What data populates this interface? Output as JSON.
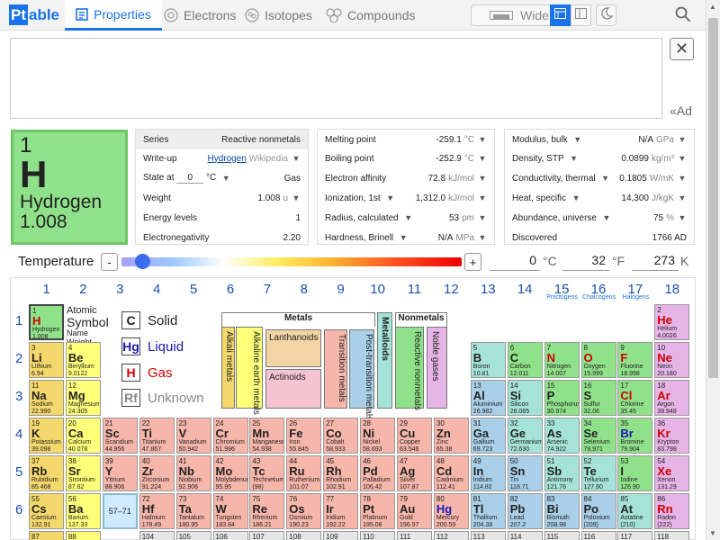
{
  "app": {
    "logo_pt": "Pt",
    "logo_rest": "able"
  },
  "tabs": [
    {
      "label": "Properties"
    },
    {
      "label": "Electrons"
    },
    {
      "label": "Isotopes"
    },
    {
      "label": "Compounds"
    }
  ],
  "toolbar": {
    "wide_label": "Wide"
  },
  "search": {
    "add_hint": "«Ad"
  },
  "element": {
    "number": "1",
    "symbol": "H",
    "name": "Hydrogen",
    "weight": "1.008",
    "color": "#90e28a"
  },
  "panel1": {
    "series_label": "Series",
    "series_value": "Reactive nonmetals",
    "writeup_label": "Write-up",
    "writeup_link": "Hydrogen",
    "writeup_source": "Wikipedia",
    "state_label": "State at",
    "state_temp": "0",
    "state_unit": "°C",
    "state_value": "Gas",
    "weight_label": "Weight",
    "weight_value": "1.008",
    "weight_unit": "u",
    "energy_label": "Energy levels",
    "energy_value": "1",
    "eneg_label": "Electronegativity",
    "eneg_value": "2.20"
  },
  "panel2": {
    "melt_label": "Melting point",
    "melt_value": "-259.1",
    "melt_unit": "°C",
    "boil_label": "Boiling point",
    "boil_value": "-252.9",
    "boil_unit": "°C",
    "ea_label": "Electron affinity",
    "ea_value": "72.8",
    "ea_unit": "kJ/mol",
    "ion_label": "Ionization, 1st",
    "ion_value": "1,312.0",
    "ion_unit": "kJ/mol",
    "rad_label": "Radius, calculated",
    "rad_value": "53",
    "rad_unit": "pm",
    "hard_label": "Hardness, Brinell",
    "hard_value": "N/A",
    "hard_unit": "MPa"
  },
  "panel3": {
    "mod_label": "Modulus, bulk",
    "mod_value": "N/A",
    "mod_unit": "GPa",
    "dens_label": "Density, STP",
    "dens_value": "0.0899",
    "dens_unit": "kg/m³",
    "cond_label": "Conductivity, thermal",
    "cond_value": "0.1805",
    "cond_unit": "W/mK",
    "heat_label": "Heat, specific",
    "heat_value": "14,300",
    "heat_unit": "J/kgK",
    "abund_label": "Abundance, universe",
    "abund_value": "75",
    "abund_unit": "%",
    "disc_label": "Discovered",
    "disc_value": "1766 AD"
  },
  "temperature": {
    "label": "Temperature",
    "minus": "-",
    "plus": "+",
    "celsius": "0",
    "c_unit": "°C",
    "fahrenheit": "32",
    "f_unit": "°F",
    "kelvin": "273",
    "k_unit": "K"
  },
  "groups": [
    "1",
    "2",
    "3",
    "4",
    "5",
    "6",
    "7",
    "8",
    "9",
    "10",
    "11",
    "12",
    "13",
    "14",
    "15",
    "16",
    "17",
    "18"
  ],
  "group_names": {
    "g15": "Pnictogens",
    "g16": "Chalcogens",
    "g17": "Halogens"
  },
  "periods": [
    "1",
    "2",
    "3",
    "4",
    "5",
    "6"
  ],
  "key": {
    "atomic": "Atomic",
    "symbol": "Symbol",
    "name": "Name",
    "weight": "Weight"
  },
  "legend": {
    "solid_sym": "C",
    "solid": "Solid",
    "liquid_sym": "Hg",
    "liquid": "Liquid",
    "gas_sym": "H",
    "gas": "Gas",
    "unk_sym": "Rf",
    "unknown": "Unknown"
  },
  "categories": {
    "metals": "Metals",
    "alkali": "Alkali metals",
    "alkaline": "Alkaline earth metals",
    "lanthanoids": "Lanthanoids",
    "actinoids": "Actinoids",
    "transition": "Transition metals",
    "post": "Post-transition metals",
    "metalloids": "Metalloids",
    "nonmetals": "Nonmetals",
    "reactive": "Reactive nonmetals",
    "noble": "Noble gases"
  },
  "lanth_placeholder": "57–71",
  "elements": [
    {
      "n": "1",
      "s": "H",
      "nm": "Hydrogen",
      "w": "1.008",
      "g": 1,
      "p": 1,
      "c": "rn",
      "st": "gas"
    },
    {
      "n": "2",
      "s": "He",
      "nm": "Helium",
      "w": "4.0026",
      "g": 18,
      "p": 1,
      "c": "ng",
      "st": "gas"
    },
    {
      "n": "3",
      "s": "Li",
      "nm": "Lithium",
      "w": "6.94",
      "g": 1,
      "p": 2,
      "c": "alk"
    },
    {
      "n": "4",
      "s": "Be",
      "nm": "Beryllium",
      "w": "9.0122",
      "g": 2,
      "p": 2,
      "c": "ae"
    },
    {
      "n": "5",
      "s": "B",
      "nm": "Boron",
      "w": "10.81",
      "g": 13,
      "p": 2,
      "c": "met"
    },
    {
      "n": "6",
      "s": "C",
      "nm": "Carbon",
      "w": "12.011",
      "g": 14,
      "p": 2,
      "c": "rn"
    },
    {
      "n": "7",
      "s": "N",
      "nm": "Nitrogen",
      "w": "14.007",
      "g": 15,
      "p": 2,
      "c": "rn",
      "st": "gas"
    },
    {
      "n": "8",
      "s": "O",
      "nm": "Oxygen",
      "w": "15.999",
      "g": 16,
      "p": 2,
      "c": "rn",
      "st": "gas"
    },
    {
      "n": "9",
      "s": "F",
      "nm": "Fluorine",
      "w": "18.998",
      "g": 17,
      "p": 2,
      "c": "rn",
      "st": "gas"
    },
    {
      "n": "10",
      "s": "Ne",
      "nm": "Neon",
      "w": "20.180",
      "g": 18,
      "p": 2,
      "c": "ng",
      "st": "gas"
    },
    {
      "n": "11",
      "s": "Na",
      "nm": "Sodium",
      "w": "22.990",
      "g": 1,
      "p": 3,
      "c": "alk"
    },
    {
      "n": "12",
      "s": "Mg",
      "nm": "Magnesium",
      "w": "24.305",
      "g": 2,
      "p": 3,
      "c": "ae"
    },
    {
      "n": "13",
      "s": "Al",
      "nm": "Aluminium",
      "w": "26.982",
      "g": 13,
      "p": 3,
      "c": "pt"
    },
    {
      "n": "14",
      "s": "Si",
      "nm": "Silicon",
      "w": "28.085",
      "g": 14,
      "p": 3,
      "c": "met"
    },
    {
      "n": "15",
      "s": "P",
      "nm": "Phosphorus",
      "w": "30.974",
      "g": 15,
      "p": 3,
      "c": "rn"
    },
    {
      "n": "16",
      "s": "S",
      "nm": "Sulfur",
      "w": "32.06",
      "g": 16,
      "p": 3,
      "c": "rn"
    },
    {
      "n": "17",
      "s": "Cl",
      "nm": "Chlorine",
      "w": "35.45",
      "g": 17,
      "p": 3,
      "c": "rn",
      "st": "gas"
    },
    {
      "n": "18",
      "s": "Ar",
      "nm": "Argon",
      "w": "39.948",
      "g": 18,
      "p": 3,
      "c": "ng",
      "st": "gas"
    },
    {
      "n": "19",
      "s": "K",
      "nm": "Potassium",
      "w": "39.098",
      "g": 1,
      "p": 4,
      "c": "alk"
    },
    {
      "n": "20",
      "s": "Ca",
      "nm": "Calcium",
      "w": "40.078",
      "g": 2,
      "p": 4,
      "c": "ae"
    },
    {
      "n": "21",
      "s": "Sc",
      "nm": "Scandium",
      "w": "44.956",
      "g": 3,
      "p": 4,
      "c": "tr"
    },
    {
      "n": "22",
      "s": "Ti",
      "nm": "Titanium",
      "w": "47.867",
      "g": 4,
      "p": 4,
      "c": "tr"
    },
    {
      "n": "23",
      "s": "V",
      "nm": "Vanadium",
      "w": "50.942",
      "g": 5,
      "p": 4,
      "c": "tr"
    },
    {
      "n": "24",
      "s": "Cr",
      "nm": "Chromium",
      "w": "51.996",
      "g": 6,
      "p": 4,
      "c": "tr"
    },
    {
      "n": "25",
      "s": "Mn",
      "nm": "Manganese",
      "w": "54.938",
      "g": 7,
      "p": 4,
      "c": "tr"
    },
    {
      "n": "26",
      "s": "Fe",
      "nm": "Iron",
      "w": "55.845",
      "g": 8,
      "p": 4,
      "c": "tr"
    },
    {
      "n": "27",
      "s": "Co",
      "nm": "Cobalt",
      "w": "58.933",
      "g": 9,
      "p": 4,
      "c": "tr"
    },
    {
      "n": "28",
      "s": "Ni",
      "nm": "Nickel",
      "w": "58.693",
      "g": 10,
      "p": 4,
      "c": "tr"
    },
    {
      "n": "29",
      "s": "Cu",
      "nm": "Copper",
      "w": "63.546",
      "g": 11,
      "p": 4,
      "c": "tr"
    },
    {
      "n": "30",
      "s": "Zn",
      "nm": "Zinc",
      "w": "65.38",
      "g": 12,
      "p": 4,
      "c": "tr"
    },
    {
      "n": "31",
      "s": "Ga",
      "nm": "Gallium",
      "w": "69.723",
      "g": 13,
      "p": 4,
      "c": "pt"
    },
    {
      "n": "32",
      "s": "Ge",
      "nm": "Germanium",
      "w": "72.630",
      "g": 14,
      "p": 4,
      "c": "met"
    },
    {
      "n": "33",
      "s": "As",
      "nm": "Arsenic",
      "w": "74.922",
      "g": 15,
      "p": 4,
      "c": "met"
    },
    {
      "n": "34",
      "s": "Se",
      "nm": "Selenium",
      "w": "78.971",
      "g": 16,
      "p": 4,
      "c": "rn"
    },
    {
      "n": "35",
      "s": "Br",
      "nm": "Bromine",
      "w": "79.904",
      "g": 17,
      "p": 4,
      "c": "rn",
      "st": "liq"
    },
    {
      "n": "36",
      "s": "Kr",
      "nm": "Krypton",
      "w": "83.798",
      "g": 18,
      "p": 4,
      "c": "ng",
      "st": "gas"
    },
    {
      "n": "37",
      "s": "Rb",
      "nm": "Rubidium",
      "w": "85.468",
      "g": 1,
      "p": 5,
      "c": "alk"
    },
    {
      "n": "38",
      "s": "Sr",
      "nm": "Strontium",
      "w": "87.62",
      "g": 2,
      "p": 5,
      "c": "ae"
    },
    {
      "n": "39",
      "s": "Y",
      "nm": "Yttrium",
      "w": "88.906",
      "g": 3,
      "p": 5,
      "c": "tr"
    },
    {
      "n": "40",
      "s": "Zr",
      "nm": "Zirconium",
      "w": "91.224",
      "g": 4,
      "p": 5,
      "c": "tr"
    },
    {
      "n": "41",
      "s": "Nb",
      "nm": "Niobium",
      "w": "92.906",
      "g": 5,
      "p": 5,
      "c": "tr"
    },
    {
      "n": "42",
      "s": "Mo",
      "nm": "Molybdenum",
      "w": "95.95",
      "g": 6,
      "p": 5,
      "c": "tr"
    },
    {
      "n": "43",
      "s": "Tc",
      "nm": "Technetium",
      "w": "(98)",
      "g": 7,
      "p": 5,
      "c": "tr"
    },
    {
      "n": "44",
      "s": "Ru",
      "nm": "Ruthenium",
      "w": "101.07",
      "g": 8,
      "p": 5,
      "c": "tr"
    },
    {
      "n": "45",
      "s": "Rh",
      "nm": "Rhodium",
      "w": "102.91",
      "g": 9,
      "p": 5,
      "c": "tr"
    },
    {
      "n": "46",
      "s": "Pd",
      "nm": "Palladium",
      "w": "106.42",
      "g": 10,
      "p": 5,
      "c": "tr"
    },
    {
      "n": "47",
      "s": "Ag",
      "nm": "Silver",
      "w": "107.87",
      "g": 11,
      "p": 5,
      "c": "tr"
    },
    {
      "n": "48",
      "s": "Cd",
      "nm": "Cadmium",
      "w": "112.41",
      "g": 12,
      "p": 5,
      "c": "tr"
    },
    {
      "n": "49",
      "s": "In",
      "nm": "Indium",
      "w": "114.82",
      "g": 13,
      "p": 5,
      "c": "pt"
    },
    {
      "n": "50",
      "s": "Sn",
      "nm": "Tin",
      "w": "118.71",
      "g": 14,
      "p": 5,
      "c": "pt"
    },
    {
      "n": "51",
      "s": "Sb",
      "nm": "Antimony",
      "w": "121.76",
      "g": 15,
      "p": 5,
      "c": "met"
    },
    {
      "n": "52",
      "s": "Te",
      "nm": "Tellurium",
      "w": "127.60",
      "g": 16,
      "p": 5,
      "c": "met"
    },
    {
      "n": "53",
      "s": "I",
      "nm": "Iodine",
      "w": "126.90",
      "g": 17,
      "p": 5,
      "c": "rn"
    },
    {
      "n": "54",
      "s": "Xe",
      "nm": "Xenon",
      "w": "131.29",
      "g": 18,
      "p": 5,
      "c": "ng",
      "st": "gas"
    },
    {
      "n": "55",
      "s": "Cs",
      "nm": "Caesium",
      "w": "132.91",
      "g": 1,
      "p": 6,
      "c": "alk"
    },
    {
      "n": "56",
      "s": "Ba",
      "nm": "Barium",
      "w": "137.33",
      "g": 2,
      "p": 6,
      "c": "ae"
    },
    {
      "n": "72",
      "s": "Hf",
      "nm": "Hafnium",
      "w": "178.49",
      "g": 4,
      "p": 6,
      "c": "tr"
    },
    {
      "n": "73",
      "s": "Ta",
      "nm": "Tantalum",
      "w": "180.95",
      "g": 5,
      "p": 6,
      "c": "tr"
    },
    {
      "n": "74",
      "s": "W",
      "nm": "Tungsten",
      "w": "183.84",
      "g": 6,
      "p": 6,
      "c": "tr"
    },
    {
      "n": "75",
      "s": "Re",
      "nm": "Rhenium",
      "w": "186.21",
      "g": 7,
      "p": 6,
      "c": "tr"
    },
    {
      "n": "76",
      "s": "Os",
      "nm": "Osmium",
      "w": "190.23",
      "g": 8,
      "p": 6,
      "c": "tr"
    },
    {
      "n": "77",
      "s": "Ir",
      "nm": "Iridium",
      "w": "192.22",
      "g": 9,
      "p": 6,
      "c": "tr"
    },
    {
      "n": "78",
      "s": "Pt",
      "nm": "Platinum",
      "w": "195.08",
      "g": 10,
      "p": 6,
      "c": "tr"
    },
    {
      "n": "79",
      "s": "Au",
      "nm": "Gold",
      "w": "196.97",
      "g": 11,
      "p": 6,
      "c": "tr"
    },
    {
      "n": "80",
      "s": "Hg",
      "nm": "Mercury",
      "w": "200.59",
      "g": 12,
      "p": 6,
      "c": "tr",
      "st": "liq"
    },
    {
      "n": "81",
      "s": "Tl",
      "nm": "Thallium",
      "w": "204.38",
      "g": 13,
      "p": 6,
      "c": "pt"
    },
    {
      "n": "82",
      "s": "Pb",
      "nm": "Lead",
      "w": "207.2",
      "g": 14,
      "p": 6,
      "c": "pt"
    },
    {
      "n": "83",
      "s": "Bi",
      "nm": "Bismuth",
      "w": "208.98",
      "g": 15,
      "p": 6,
      "c": "pt"
    },
    {
      "n": "84",
      "s": "Po",
      "nm": "Polonium",
      "w": "(209)",
      "g": 16,
      "p": 6,
      "c": "pt"
    },
    {
      "n": "85",
      "s": "At",
      "nm": "Astatine",
      "w": "(210)",
      "g": 17,
      "p": 6,
      "c": "met"
    },
    {
      "n": "86",
      "s": "Rn",
      "nm": "Radon",
      "w": "(222)",
      "g": 18,
      "p": 6,
      "c": "ng",
      "st": "gas"
    },
    {
      "n": "87",
      "s": "",
      "nm": "",
      "w": "",
      "g": 1,
      "p": 7,
      "c": "alk"
    },
    {
      "n": "88",
      "s": "",
      "nm": "",
      "w": "",
      "g": 2,
      "p": 7,
      "c": "ae"
    },
    {
      "n": "104",
      "s": "",
      "nm": "",
      "w": "",
      "g": 4,
      "p": 7,
      "c": "unk"
    },
    {
      "n": "105",
      "s": "",
      "nm": "",
      "w": "",
      "g": 5,
      "p": 7,
      "c": "unk"
    },
    {
      "n": "106",
      "s": "",
      "nm": "",
      "w": "",
      "g": 6,
      "p": 7,
      "c": "unk"
    },
    {
      "n": "107",
      "s": "",
      "nm": "",
      "w": "",
      "g": 7,
      "p": 7,
      "c": "unk"
    },
    {
      "n": "108",
      "s": "",
      "nm": "",
      "w": "",
      "g": 8,
      "p": 7,
      "c": "unk"
    },
    {
      "n": "109",
      "s": "",
      "nm": "",
      "w": "",
      "g": 9,
      "p": 7,
      "c": "unk"
    },
    {
      "n": "110",
      "s": "",
      "nm": "",
      "w": "",
      "g": 10,
      "p": 7,
      "c": "unk"
    },
    {
      "n": "111",
      "s": "",
      "nm": "",
      "w": "",
      "g": 11,
      "p": 7,
      "c": "unk"
    },
    {
      "n": "112",
      "s": "",
      "nm": "",
      "w": "",
      "g": 12,
      "p": 7,
      "c": "unk"
    },
    {
      "n": "113",
      "s": "",
      "nm": "",
      "w": "",
      "g": 13,
      "p": 7,
      "c": "unk"
    },
    {
      "n": "114",
      "s": "",
      "nm": "",
      "w": "",
      "g": 14,
      "p": 7,
      "c": "unk"
    },
    {
      "n": "115",
      "s": "",
      "nm": "",
      "w": "",
      "g": 15,
      "p": 7,
      "c": "unk"
    },
    {
      "n": "116",
      "s": "",
      "nm": "",
      "w": "",
      "g": 16,
      "p": 7,
      "c": "unk"
    },
    {
      "n": "117",
      "s": "",
      "nm": "",
      "w": "",
      "g": 17,
      "p": 7,
      "c": "unk"
    },
    {
      "n": "118",
      "s": "",
      "nm": "",
      "w": "",
      "g": 18,
      "p": 7,
      "c": "unk"
    }
  ]
}
